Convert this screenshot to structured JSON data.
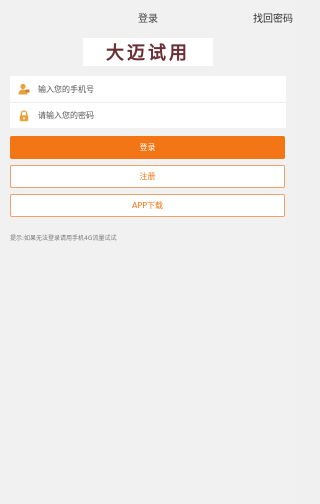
{
  "header": {
    "title": "登录",
    "right_link": "找回密码"
  },
  "logo": {
    "text": "大迈试用"
  },
  "form": {
    "phone_placeholder": "输入您的手机号",
    "password_placeholder": "请输入您的密码",
    "phone_value": "",
    "password_value": ""
  },
  "buttons": {
    "login": "登录",
    "register": "注册",
    "app_download": "APP下载"
  },
  "tip": "提示:如果无法登录请用手机4G流量试试",
  "colors": {
    "accent": "#f47515",
    "logo": "#6a2f36"
  }
}
